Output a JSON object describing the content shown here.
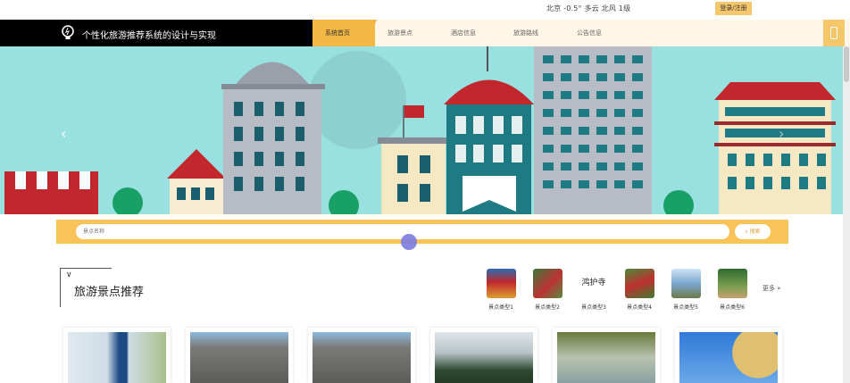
{
  "topbar": {
    "weather": "北京  -0.5°  多云  北风  1级",
    "login_label": "登录/注册"
  },
  "header": {
    "site_title": "个性化旅游推荐系统的设计与实现"
  },
  "nav": {
    "items": [
      {
        "label": "系统首页",
        "active": true
      },
      {
        "label": "旅游景点",
        "active": false
      },
      {
        "label": "酒店信息",
        "active": false
      },
      {
        "label": "旅游路线",
        "active": false
      },
      {
        "label": "公告信息",
        "active": false
      }
    ]
  },
  "banner": {
    "prev_symbol": "‹",
    "next_symbol": "›"
  },
  "search": {
    "placeholder": "景点名称",
    "button_label": "搜索"
  },
  "section": {
    "title": "旅游景点推荐",
    "more_label": "更多 »",
    "categories": [
      {
        "label": "景点类型1"
      },
      {
        "label": "景点类型2"
      },
      {
        "label": "景点类型3",
        "image_text": "鸿护寺"
      },
      {
        "label": "景点类型4"
      },
      {
        "label": "景点类型5"
      },
      {
        "label": "景点类型6"
      }
    ]
  },
  "colors": {
    "accent": "#f3b744",
    "search_bg": "#f9c35a",
    "banner_sky": "#99e0e0",
    "brand_bg": "#000000"
  }
}
